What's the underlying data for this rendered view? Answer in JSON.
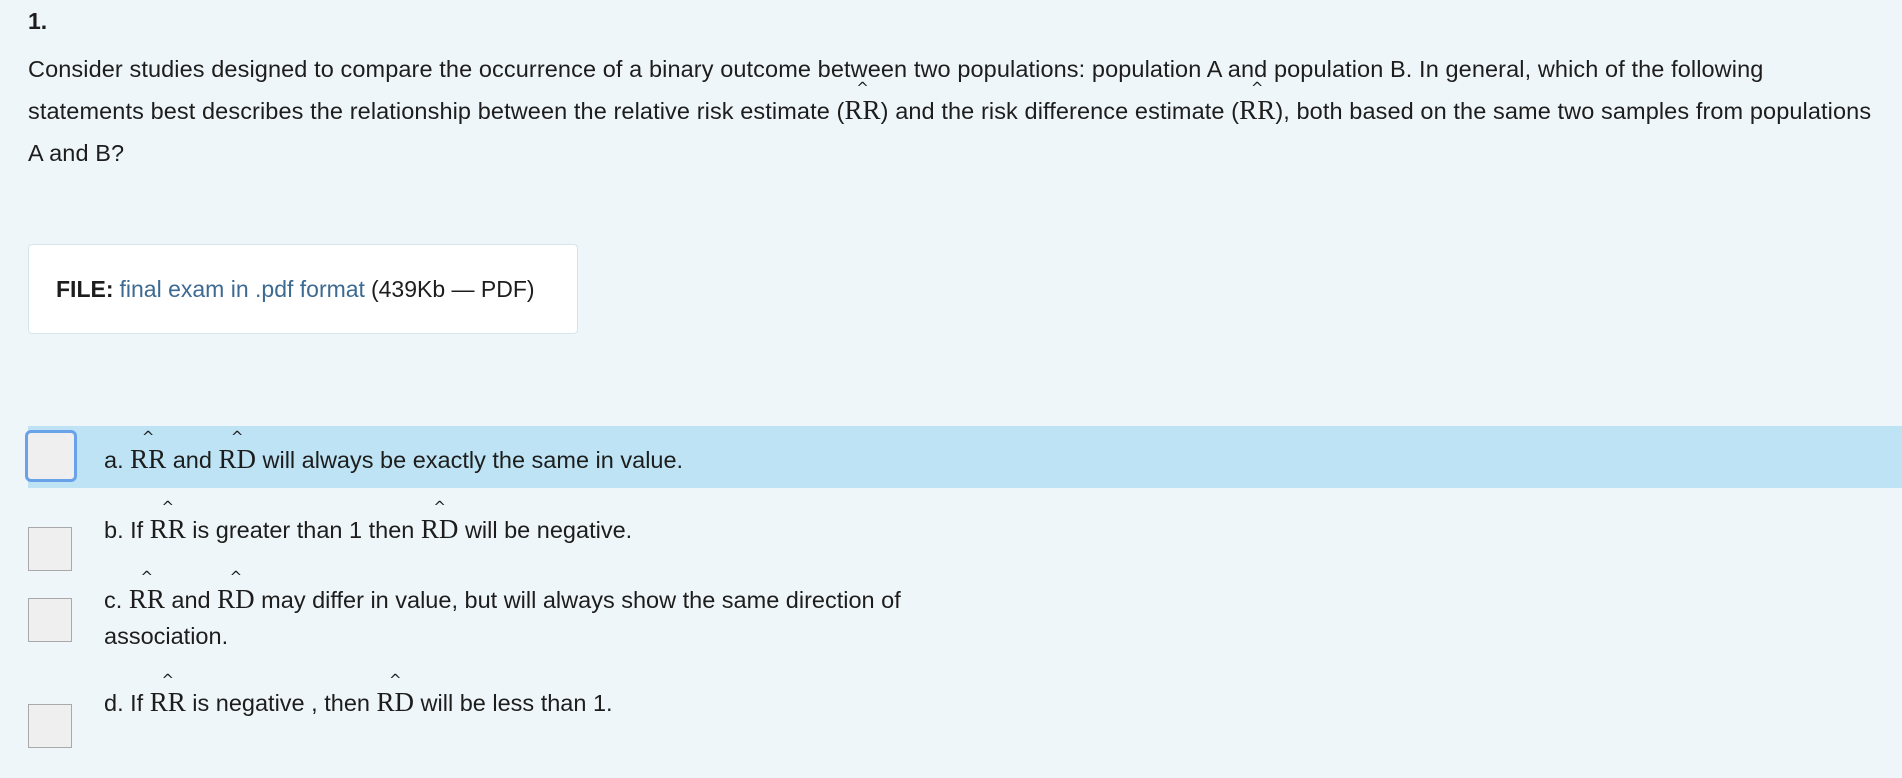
{
  "question": {
    "number": "1.",
    "text_1": "Consider studies designed to compare the occurrence of a binary outcome between two populations: population A and population B. In general, which of the following statements best describes the relationship between the relative risk estimate (",
    "math_1": "RR",
    "text_2": ") and the risk difference estimate (",
    "math_2": "RR",
    "text_3": "), both based on the same two samples from populations A and B?"
  },
  "file": {
    "label": "FILE:",
    "link_text": "final exam in .pdf format",
    "meta": "(439Kb — PDF)"
  },
  "hat_symbol": "^",
  "options": [
    {
      "id": "a",
      "prefix": "a.",
      "math_1": "RR",
      "mid": "and",
      "math_2": "RD",
      "suffix": "will always be exactly the same in value.",
      "selected": true
    },
    {
      "id": "b",
      "prefix": "b. If",
      "math_1": "RR",
      "mid": "is greater than 1 then",
      "math_2": "RD",
      "suffix": "will be negative.",
      "selected": false
    },
    {
      "id": "c",
      "prefix": "c.",
      "math_1": "RR",
      "mid": "and",
      "math_2": "RD",
      "suffix_line1": "may differ in value, but will always show the same direction of",
      "suffix_line2": "association.",
      "selected": false
    },
    {
      "id": "d",
      "prefix": "d. If",
      "math_1": "RR",
      "mid": "is negative , then",
      "math_2": "RD",
      "suffix": "will be less than 1.",
      "selected": false
    }
  ]
}
